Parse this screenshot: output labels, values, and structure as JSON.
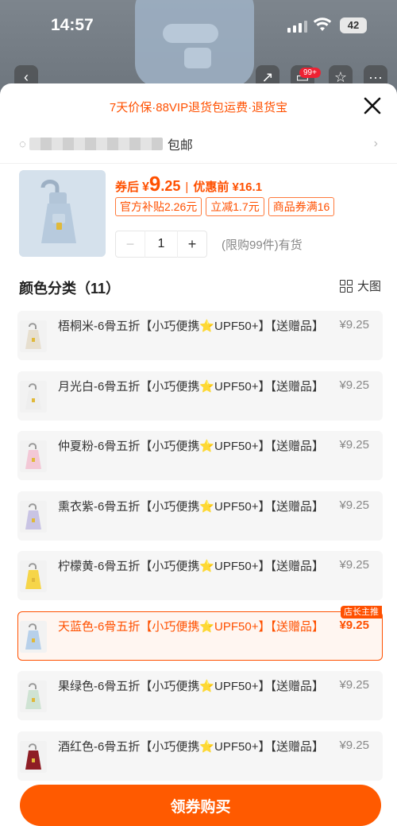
{
  "status_bar": {
    "time": "14:57",
    "battery": "42"
  },
  "background": {
    "cart_badge": "99+"
  },
  "sheet": {
    "banner": "7天价保·88VIP退货包运费·退货宝",
    "address_suffix": "包邮",
    "product": {
      "price_prefix": "券后",
      "price_currency": "¥",
      "price_integer": "9",
      "price_decimal": ".25",
      "price_separator": "|",
      "original_price_label": "优惠前 ¥16.1",
      "coupons": [
        "官方补贴2.26元",
        "立减1.7元",
        "商品券满16"
      ],
      "quantity": "1",
      "stock_note": "(限购99件)有货"
    },
    "section_title": "颜色分类（11）",
    "big_view_label": "大图",
    "options": [
      {
        "name": "梧桐米-6骨五折【小巧便携⭐UPF50+】【送赠品】",
        "price": "¥9.25",
        "swatch": "#e7dfcf",
        "selected": false
      },
      {
        "name": "月光白-6骨五折【小巧便携⭐UPF50+】【送赠品】",
        "price": "¥9.25",
        "swatch": "#eeeeee",
        "selected": false
      },
      {
        "name": "仲夏粉-6骨五折【小巧便携⭐UPF50+】【送赠品】",
        "price": "¥9.25",
        "swatch": "#f3c8d6",
        "selected": false
      },
      {
        "name": "熏衣紫-6骨五折【小巧便携⭐UPF50+】【送赠品】",
        "price": "¥9.25",
        "swatch": "#c9c4e4",
        "selected": false
      },
      {
        "name": "柠檬黄-6骨五折【小巧便携⭐UPF50+】【送赠品】",
        "price": "¥9.25",
        "swatch": "#f6d548",
        "selected": false
      },
      {
        "name": "天蓝色-6骨五折【小巧便携⭐UPF50+】【送赠品】",
        "price": "¥9.25",
        "swatch": "#b7d0ea",
        "selected": true,
        "tag": "店长主推"
      },
      {
        "name": "果绿色-6骨五折【小巧便携⭐UPF50+】【送赠品】",
        "price": "¥9.25",
        "swatch": "#cfe3d3",
        "selected": false
      },
      {
        "name": "酒红色-6骨五折【小巧便携⭐UPF50+】【送赠品】",
        "price": "¥9.25",
        "swatch": "#8e1d24",
        "selected": false
      }
    ],
    "buy_button": "领券购买"
  },
  "colors": {
    "accent": "#ff5000",
    "buy_button": "#ff5a00"
  }
}
